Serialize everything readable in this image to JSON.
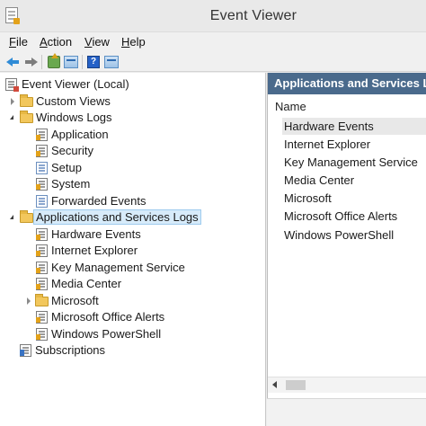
{
  "window": {
    "title": "Event Viewer",
    "icon": "event-viewer-icon"
  },
  "menu": [
    {
      "pre": "",
      "u": "F",
      "post": "ile"
    },
    {
      "pre": "",
      "u": "A",
      "post": "ction"
    },
    {
      "pre": "",
      "u": "V",
      "post": "iew"
    },
    {
      "pre": "",
      "u": "H",
      "post": "elp"
    }
  ],
  "toolbar": {
    "buttons": [
      "back-arrow-icon",
      "forward-arrow-icon",
      "up-level-icon",
      "show-hide-console-tree-icon",
      "help-icon",
      "show-hide-action-pane-icon"
    ],
    "help_glyph": "?"
  },
  "tree": [
    {
      "label": "Event Viewer (Local)",
      "icon": "event-viewer-icon",
      "twisty": "none",
      "level": 0
    },
    {
      "label": "Custom Views",
      "icon": "folder-icon",
      "twisty": "closed",
      "level": 1
    },
    {
      "label": "Windows Logs",
      "icon": "folder-icon",
      "twisty": "open",
      "level": 1
    },
    {
      "label": "Application",
      "icon": "log-icon",
      "twisty": "none",
      "level": 2
    },
    {
      "label": "Security",
      "icon": "log-icon",
      "twisty": "none",
      "level": 2
    },
    {
      "label": "Setup",
      "icon": "log-plain-icon",
      "twisty": "none",
      "level": 2
    },
    {
      "label": "System",
      "icon": "log-icon",
      "twisty": "none",
      "level": 2
    },
    {
      "label": "Forwarded Events",
      "icon": "log-plain-icon",
      "twisty": "none",
      "level": 2
    },
    {
      "label": "Applications and Services Logs",
      "icon": "folder-icon",
      "twisty": "open",
      "level": 1,
      "selected": true
    },
    {
      "label": "Hardware Events",
      "icon": "log-icon",
      "twisty": "none",
      "level": 2
    },
    {
      "label": "Internet Explorer",
      "icon": "log-icon",
      "twisty": "none",
      "level": 2
    },
    {
      "label": "Key Management Service",
      "icon": "log-icon",
      "twisty": "none",
      "level": 2
    },
    {
      "label": "Media Center",
      "icon": "log-icon",
      "twisty": "none",
      "level": 2
    },
    {
      "label": "Microsoft",
      "icon": "folder-icon",
      "twisty": "closed",
      "level": 2
    },
    {
      "label": "Microsoft Office Alerts",
      "icon": "log-icon",
      "twisty": "none",
      "level": 2
    },
    {
      "label": "Windows PowerShell",
      "icon": "log-icon",
      "twisty": "none",
      "level": 2
    },
    {
      "label": "Subscriptions",
      "icon": "log-blue-icon",
      "twisty": "none",
      "level": 1
    }
  ],
  "right_pane": {
    "header": "Applications and Services L...",
    "column": "Name",
    "items": [
      {
        "label": "Hardware Events",
        "selected": true
      },
      {
        "label": "Internet Explorer"
      },
      {
        "label": "Key Management Service"
      },
      {
        "label": "Media Center"
      },
      {
        "label": "Microsoft"
      },
      {
        "label": "Microsoft Office Alerts"
      },
      {
        "label": "Windows PowerShell"
      }
    ]
  },
  "colors": {
    "accent_header": "#4a6a8c",
    "selection": "#d7ebfa"
  }
}
